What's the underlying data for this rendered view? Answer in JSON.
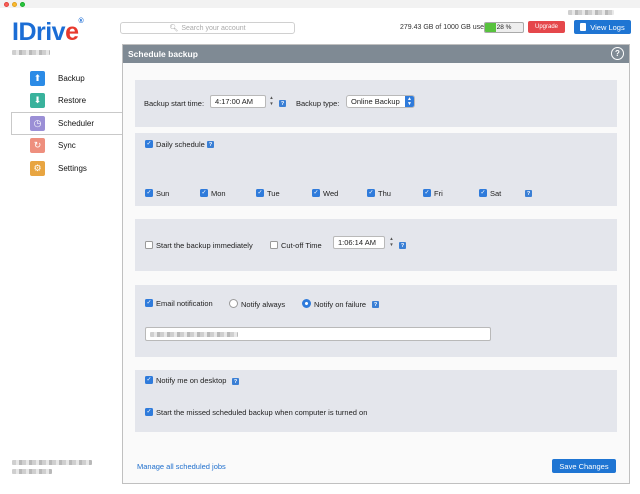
{
  "app": {
    "logo": "IDriv",
    "logo_e": "e",
    "logo_reg": "®"
  },
  "sidebar": {
    "items": [
      {
        "label": "Backup",
        "icon": "backup-arrow-up-icon",
        "color": "#2b8be6",
        "glyph": "⬆"
      },
      {
        "label": "Restore",
        "icon": "restore-arrow-down-icon",
        "color": "#39b29c",
        "glyph": "⬇"
      },
      {
        "label": "Scheduler",
        "icon": "scheduler-clock-icon",
        "color": "#9b8fd6",
        "glyph": "◷"
      },
      {
        "label": "Sync",
        "icon": "sync-icon",
        "color": "#ee8f7e",
        "glyph": "↻"
      },
      {
        "label": "Settings",
        "icon": "settings-gear-icon",
        "color": "#e8a541",
        "glyph": "⚙"
      }
    ],
    "active": "Scheduler"
  },
  "topbar": {
    "search_placeholder": "Search your account",
    "usage_text": "279.43 GB of 1000 GB used",
    "usage_percent_label": "28 %",
    "usage_fraction": 0.28,
    "upgrade_label": "Upgrade",
    "view_logs_label": "View Logs"
  },
  "panel": {
    "title": "Schedule backup",
    "help": "?",
    "start_time_label": "Backup start time:",
    "start_time_value": "4:17:00 AM",
    "backup_type_label": "Backup type:",
    "backup_type_value": "Online Backup",
    "daily_schedule_label": "Daily schedule",
    "days": [
      "Sun",
      "Mon",
      "Tue",
      "Wed",
      "Thu",
      "Fri",
      "Sat"
    ],
    "start_immediately_label": "Start the backup immediately",
    "cutoff_label": "Cut-off Time",
    "cutoff_value": "1:06:14 AM",
    "email_notification_label": "Email notification",
    "notify_always_label": "Notify always",
    "notify_failure_label": "Notify on failure",
    "notify_desktop_label": "Notify me on desktop",
    "missed_backup_label": "Start the missed scheduled backup when computer is turned on",
    "manage_link": "Manage all scheduled jobs",
    "save_label": "Save Changes"
  },
  "colors": {
    "accent": "#1f75d3",
    "panel_header": "#7f8a94",
    "upgrade": "#e5474b",
    "usage_fill": "#58c23e"
  }
}
